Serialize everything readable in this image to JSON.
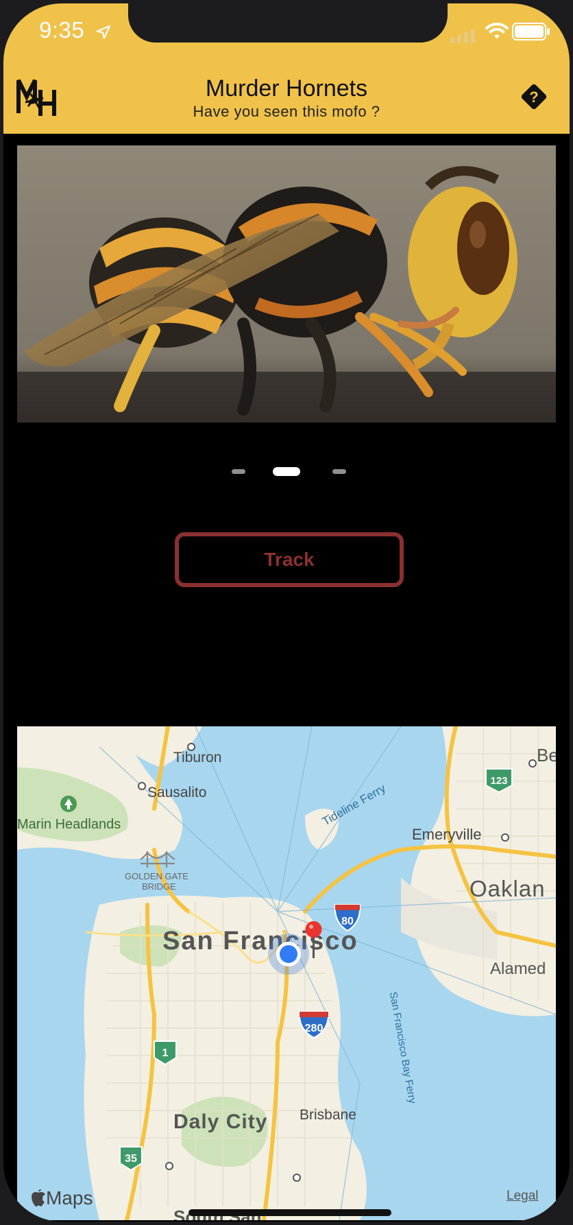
{
  "status_bar": {
    "time": "9:35"
  },
  "header": {
    "title": "Murder Hornets",
    "subtitle": "Have you seen this mofo ?",
    "logo_text": "MH",
    "help_label": "?",
    "background_color": "#f0c24a"
  },
  "carousel": {
    "page_count": 3,
    "current_page": 2
  },
  "track_button": {
    "label": "Track",
    "color": "#8b3030"
  },
  "map": {
    "labels": {
      "tiburon": "Tiburon",
      "sausalito": "Sausalito",
      "marin": "Marin Headlands",
      "ferry": "Tideline Ferry",
      "emeryville": "Emeryville",
      "oakland": "Oaklan",
      "berkeley": "Be",
      "gg1": "GOLDEN GATE",
      "gg2": "BRIDGE",
      "sf": "San Francisco",
      "alameda": "Alamed",
      "bayferry": "San Francisco Bay Ferry",
      "daly": "Daly City",
      "brisbane": "Brisbane",
      "south": "South San"
    },
    "shields": {
      "i80": "80",
      "i280": "280",
      "r123": "123",
      "r1": "1",
      "r35": "35"
    },
    "attribution": "Maps",
    "legal": "Legal"
  }
}
